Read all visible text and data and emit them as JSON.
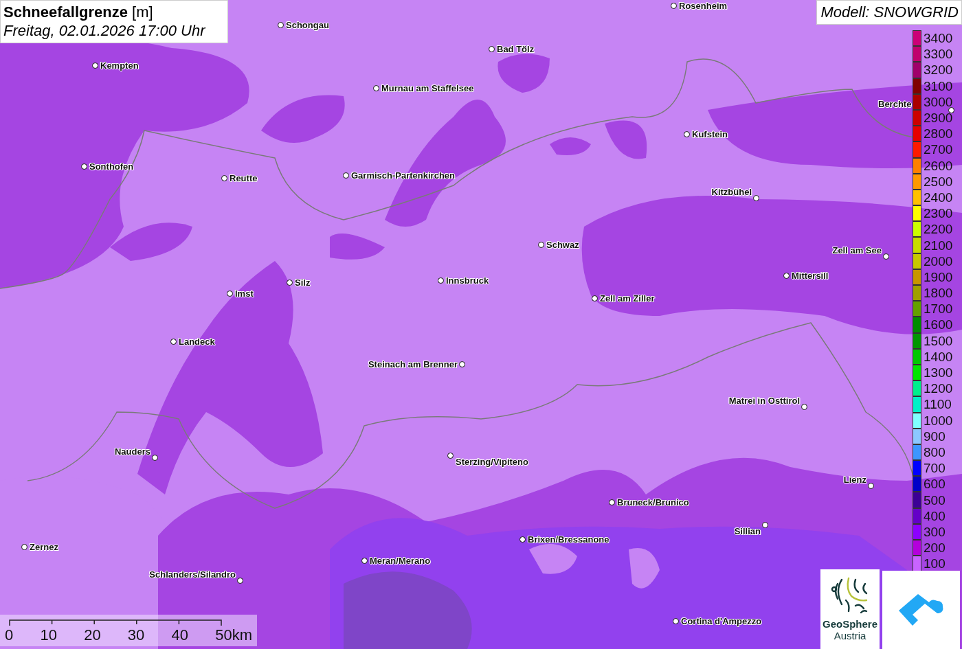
{
  "title": {
    "heading": "**Schneefallgrenze** [m]",
    "subtitle": "Freitag, 02.01.2026 17:00 Uhr"
  },
  "model_label": "Modell: SNOWGRID",
  "cities": [
    {
      "name": "Rosenheim"
    },
    {
      "name": "Schongau"
    },
    {
      "name": "Bad Tölz"
    },
    {
      "name": "Kempten"
    },
    {
      "name": "Murnau am Staffelsee"
    },
    {
      "name": "Berchte"
    },
    {
      "name": "Kufstein"
    },
    {
      "name": "Sonthofen"
    },
    {
      "name": "Reutte"
    },
    {
      "name": "Garmisch-Partenkirchen"
    },
    {
      "name": "Kitzbühel"
    },
    {
      "name": "Schwaz"
    },
    {
      "name": "Zell am See"
    },
    {
      "name": "Mittersill"
    },
    {
      "name": "Innsbruck"
    },
    {
      "name": "Silz"
    },
    {
      "name": "Imst"
    },
    {
      "name": "Zell am Ziller"
    },
    {
      "name": "Landeck"
    },
    {
      "name": "Steinach am Brenner"
    },
    {
      "name": "Matrei in Osttirol"
    },
    {
      "name": "Nauders"
    },
    {
      "name": "Sterzing/Vipiteno"
    },
    {
      "name": "Lienz"
    },
    {
      "name": "Bruneck/Brunico"
    },
    {
      "name": "Sillian"
    },
    {
      "name": "Brixen/Bressanone"
    },
    {
      "name": "Zernez"
    },
    {
      "name": "Meran/Merano"
    },
    {
      "name": "Schlanders/Silandro"
    },
    {
      "name": "Cortina d'Ampezzo"
    }
  ],
  "legend": [
    {
      "label": "3400",
      "color": "#cc0077"
    },
    {
      "label": "3300",
      "color": "#c0006e"
    },
    {
      "label": "3200",
      "color": "#a0006a"
    },
    {
      "label": "3100",
      "color": "#800000"
    },
    {
      "label": "3000",
      "color": "#aa0000"
    },
    {
      "label": "2900",
      "color": "#cc0000"
    },
    {
      "label": "2800",
      "color": "#e60000"
    },
    {
      "label": "2700",
      "color": "#ff1a00"
    },
    {
      "label": "2600",
      "color": "#ff8000"
    },
    {
      "label": "2500",
      "color": "#ff9900"
    },
    {
      "label": "2400",
      "color": "#ffc000"
    },
    {
      "label": "2300",
      "color": "#ffff00"
    },
    {
      "label": "2200",
      "color": "#ccff00"
    },
    {
      "label": "2100",
      "color": "#c8dc00"
    },
    {
      "label": "2000",
      "color": "#c8c800"
    },
    {
      "label": "1900",
      "color": "#c89600"
    },
    {
      "label": "1800",
      "color": "#a0a000"
    },
    {
      "label": "1700",
      "color": "#64a000"
    },
    {
      "label": "1600",
      "color": "#008c00"
    },
    {
      "label": "1500",
      "color": "#009600"
    },
    {
      "label": "1400",
      "color": "#00c800"
    },
    {
      "label": "1300",
      "color": "#00e600"
    },
    {
      "label": "1200",
      "color": "#00f08c"
    },
    {
      "label": "1100",
      "color": "#00f0c8"
    },
    {
      "label": "1000",
      "color": "#80ffff"
    },
    {
      "label": "900",
      "color": "#8cc8ff"
    },
    {
      "label": "800",
      "color": "#3c96ff"
    },
    {
      "label": "700",
      "color": "#0000ff"
    },
    {
      "label": "600",
      "color": "#0000c8"
    },
    {
      "label": "500",
      "color": "#3c0096"
    },
    {
      "label": "400",
      "color": "#6400c8"
    },
    {
      "label": "300",
      "color": "#8c00ff"
    },
    {
      "label": "200",
      "color": "#b400dc"
    },
    {
      "label": "100",
      "color": "#c864ff"
    }
  ],
  "scale_bar": {
    "ticks": [
      "0",
      "10",
      "20",
      "30",
      "40",
      "50km"
    ]
  },
  "logos": {
    "geosphere": {
      "name": "GeoSphere",
      "subname": "Austria"
    }
  }
}
